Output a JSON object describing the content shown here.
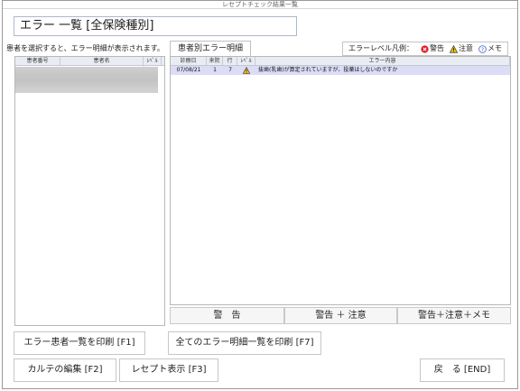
{
  "window": {
    "title": "レセプトチェック結果一覧"
  },
  "header": {
    "title": "エラー 一覧 [全保険種別]"
  },
  "hint": "患者を選択すると、エラー明細が表示されます。",
  "left_table": {
    "columns": [
      "患者番号",
      "患者名",
      "ﾚﾍﾞﾙ"
    ],
    "rows": [
      {
        "patient_no": "",
        "patient_name": "",
        "level": "caution"
      },
      {
        "patient_no": "",
        "patient_name": "",
        "level": "caution"
      },
      {
        "patient_no": "",
        "patient_name": "",
        "level": "caution"
      }
    ]
  },
  "tab": {
    "label": "患者別エラー明細"
  },
  "legend": {
    "label": "エラーレベル凡例：",
    "items": [
      {
        "icon": "error-icon",
        "label": "警告",
        "color": "#e21c2a"
      },
      {
        "icon": "caution-icon",
        "label": "注意",
        "color": "#f5c400"
      },
      {
        "icon": "memo-icon",
        "label": "メモ",
        "color": "#3a5fd0"
      }
    ]
  },
  "right_table": {
    "columns": [
      "診療日",
      "来院",
      "行",
      "ﾚﾍﾞﾙ",
      "エラー内容"
    ],
    "rows": [
      {
        "date": "07/08/21",
        "visit": "1",
        "line": "7",
        "level": "caution",
        "content": "抜歯(乳歯)が算定されていますが、投薬はしないのですか"
      }
    ]
  },
  "filters": {
    "warning": "警　告",
    "warning_caution": "警告 ＋ 注意",
    "all": "警告＋注意＋メモ"
  },
  "buttons": {
    "print_patients": "エラー患者一覧を印刷 [F1]",
    "print_all_details": "全てのエラー明細一覧を印刷 [F7]",
    "edit_chart": "カルテの編集 [F2]",
    "show_receipt": "レセプト表示 [F3]",
    "back": "戻　る [END]"
  },
  "colors": {
    "selected_row": "#dcdcf7",
    "header_bg": "#e9edf3",
    "caution": "#f5c400",
    "error": "#e21c2a"
  }
}
